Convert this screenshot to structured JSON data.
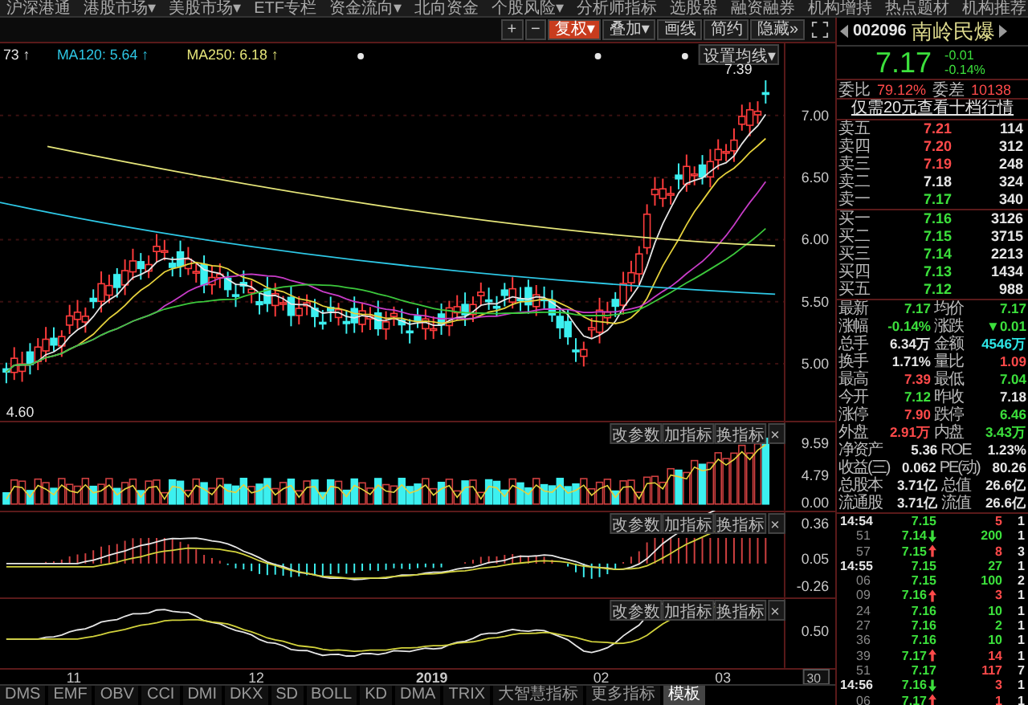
{
  "menu_bar": {
    "items": [
      "沪深港通",
      "港股市场▾",
      "美股市场▾",
      "ETF专栏",
      "资金流向▾",
      "北向资金",
      "个股风险▾",
      "分析师指标",
      "选股器",
      "融资融券",
      "机构增持",
      "热点题材",
      "机构推荐"
    ]
  },
  "toolbar": {
    "buttons": [
      {
        "label": "+",
        "selected": false
      },
      {
        "label": "−",
        "selected": false
      },
      {
        "label": "复权▾",
        "selected": true
      },
      {
        "label": "叠加▾",
        "selected": false
      },
      {
        "label": "画线",
        "selected": false
      },
      {
        "label": "简约",
        "selected": false
      },
      {
        "label": "隐藏»",
        "selected": false
      }
    ]
  },
  "main_chart": {
    "ma_legend": [
      {
        "text": "73 ↑",
        "color": "#e6e6e6"
      },
      {
        "text": "MA120: 5.64 ↑",
        "color": "#2ec8e6"
      },
      {
        "text": "MA250: 6.18 ↑",
        "color": "#e6e67a"
      }
    ],
    "ma_settings_button": "设置均线▾",
    "high_label": "7.39",
    "low_label": "4.60",
    "y_axis": [
      "7.00",
      "6.50",
      "6.00",
      "5.50",
      "5.00"
    ]
  },
  "volume_panel": {
    "y_axis": [
      "9.59",
      "4.79",
      "0.00"
    ],
    "buttons": [
      "改参数",
      "加指标",
      "换指标",
      "×"
    ]
  },
  "macd_panel": {
    "y_axis": [
      "0.36",
      "0.05",
      "-0.26"
    ],
    "buttons": [
      "改参数",
      "加指标",
      "换指标",
      "×"
    ]
  },
  "kdj_panel": {
    "y_axis": [
      "0.50"
    ],
    "buttons": [
      "改参数",
      "加指标",
      "换指标",
      "×"
    ]
  },
  "x_axis": {
    "labels": [
      "11",
      "12",
      "2019",
      "02",
      "03"
    ],
    "period_box": "30"
  },
  "indicator_tabs": [
    {
      "label": "DMS",
      "selected": false
    },
    {
      "label": "EMF",
      "selected": false
    },
    {
      "label": "OBV",
      "selected": false
    },
    {
      "label": "CCI",
      "selected": false
    },
    {
      "label": "DMI",
      "selected": false
    },
    {
      "label": "DKX",
      "selected": false
    },
    {
      "label": "SD",
      "selected": false
    },
    {
      "label": "BOLL",
      "selected": false
    },
    {
      "label": "KD",
      "selected": false
    },
    {
      "label": "DMA",
      "selected": false
    },
    {
      "label": "TRIX",
      "selected": false
    },
    {
      "label": "大智慧指标",
      "selected": false
    },
    {
      "label": "更多指标",
      "selected": false
    },
    {
      "label": "模板",
      "selected": true
    }
  ],
  "quote": {
    "code": "002096",
    "name": "南岭民爆",
    "price": "7.17",
    "change": "-0.01",
    "change_pct": "-0.14%",
    "order_ratio": [
      {
        "label": "委比",
        "value": "79.12%"
      },
      {
        "label": "委差",
        "value": "10138"
      }
    ],
    "promo_link": "仅需20元查看十档行情",
    "asks": [
      {
        "label": "卖五",
        "price": "7.21",
        "volume": "114",
        "color": "#ff4a4a"
      },
      {
        "label": "卖四",
        "price": "7.20",
        "volume": "312",
        "color": "#ff4a4a"
      },
      {
        "label": "卖三",
        "price": "7.19",
        "volume": "248",
        "color": "#ff4a4a"
      },
      {
        "label": "卖二",
        "price": "7.18",
        "volume": "324",
        "color": "#e6e6e6"
      },
      {
        "label": "卖一",
        "price": "7.17",
        "volume": "340",
        "color": "#3ce03c"
      }
    ],
    "bids": [
      {
        "label": "买一",
        "price": "7.16",
        "volume": "3126",
        "color": "#3ce03c"
      },
      {
        "label": "买二",
        "price": "7.15",
        "volume": "3715",
        "color": "#3ce03c"
      },
      {
        "label": "买三",
        "price": "7.14",
        "volume": "2213",
        "color": "#3ce03c"
      },
      {
        "label": "买四",
        "price": "7.13",
        "volume": "1434",
        "color": "#3ce03c"
      },
      {
        "label": "买五",
        "price": "7.12",
        "volume": "988",
        "color": "#3ce03c"
      }
    ],
    "stats": [
      {
        "left": {
          "label": "最新",
          "value": "7.17",
          "color": "#3ce03c"
        },
        "right": {
          "label": "均价",
          "value": "7.17",
          "color": "#3ce03c"
        }
      },
      {
        "left": {
          "label": "涨幅",
          "value": "-0.14%",
          "color": "#3ce03c"
        },
        "right": {
          "label": "涨跌",
          "value": "▼0.01",
          "color": "#3ce03c"
        }
      },
      {
        "left": {
          "label": "总手",
          "value": "6.34万",
          "color": "#e6e6e6"
        },
        "right": {
          "label": "金额",
          "value": "4546万",
          "color": "#2ee6e6"
        }
      },
      {
        "left": {
          "label": "换手",
          "value": "1.71%",
          "color": "#e6e6e6"
        },
        "right": {
          "label": "量比",
          "value": "1.09",
          "color": "#ff4a4a"
        }
      },
      {
        "left": {
          "label": "最高",
          "value": "7.39",
          "color": "#ff4a4a"
        },
        "right": {
          "label": "最低",
          "value": "7.04",
          "color": "#3ce03c"
        }
      },
      {
        "left": {
          "label": "今开",
          "value": "7.12",
          "color": "#3ce03c"
        },
        "right": {
          "label": "昨收",
          "value": "7.18",
          "color": "#e6e6e6"
        }
      },
      {
        "left": {
          "label": "涨停",
          "value": "7.90",
          "color": "#ff4a4a"
        },
        "right": {
          "label": "跌停",
          "value": "6.46",
          "color": "#3ce03c"
        }
      },
      {
        "left": {
          "label": "外盘",
          "value": "2.91万",
          "color": "#ff4a4a"
        },
        "right": {
          "label": "内盘",
          "value": "3.43万",
          "color": "#3ce03c"
        }
      },
      {
        "left": {
          "label": "净资产",
          "value": "5.36",
          "color": "#e6e6e6"
        },
        "right": {
          "label": "ROE",
          "value": "1.23%",
          "color": "#e6e6e6"
        }
      },
      {
        "left": {
          "label": "收益(三)",
          "value": "0.062",
          "color": "#e6e6e6"
        },
        "right": {
          "label": "PE(动)",
          "value": "80.26",
          "color": "#e6e6e6"
        }
      },
      {
        "left": {
          "label": "总股本",
          "value": "3.71亿",
          "color": "#e6e6e6"
        },
        "right": {
          "label": "总值",
          "value": "26.6亿",
          "color": "#e6e6e6"
        }
      },
      {
        "left": {
          "label": "流通股",
          "value": "3.71亿",
          "color": "#e6e6e6"
        },
        "right": {
          "label": "流值",
          "value": "26.6亿",
          "color": "#e6e6e6"
        }
      }
    ],
    "ticks": [
      {
        "time": "14:54",
        "kind": "minute",
        "price": "7.15",
        "volume": "5",
        "color": "#ff4a4a",
        "count": "1"
      },
      {
        "time": "51",
        "kind": "second",
        "price": "7.14",
        "rising": false,
        "volume": "200",
        "color": "#3ce03c",
        "count": "1"
      },
      {
        "time": "57",
        "kind": "second",
        "price": "7.15",
        "rising": true,
        "volume": "8",
        "color": "#ff4a4a",
        "count": "3"
      },
      {
        "time": "14:55",
        "kind": "minute",
        "price": "7.15",
        "volume": "27",
        "color": "#3ce03c",
        "count": "1"
      },
      {
        "time": "06",
        "kind": "second",
        "price": "7.15",
        "volume": "100",
        "color": "#3ce03c",
        "count": "2"
      },
      {
        "time": "09",
        "kind": "second",
        "price": "7.16",
        "rising": true,
        "volume": "3",
        "color": "#ff4a4a",
        "count": "1"
      },
      {
        "time": "24",
        "kind": "second",
        "price": "7.16",
        "volume": "10",
        "color": "#3ce03c",
        "count": "1"
      },
      {
        "time": "27",
        "kind": "second",
        "price": "7.16",
        "volume": "2",
        "color": "#3ce03c",
        "count": "1"
      },
      {
        "time": "36",
        "kind": "second",
        "price": "7.16",
        "volume": "10",
        "color": "#3ce03c",
        "count": "1"
      },
      {
        "time": "39",
        "kind": "second",
        "price": "7.17",
        "rising": true,
        "volume": "14",
        "color": "#ff4a4a",
        "count": "1"
      },
      {
        "time": "51",
        "kind": "second",
        "price": "7.17",
        "volume": "117",
        "color": "#ff4a4a",
        "count": "7"
      },
      {
        "time": "14:56",
        "kind": "minute",
        "price": "7.16",
        "rising": false,
        "volume": "3",
        "color": "#ff4a4a",
        "count": "1"
      },
      {
        "time": "06",
        "kind": "second",
        "price": "7.17",
        "rising": true,
        "volume": "1",
        "color": "#ff4a4a",
        "count": "1"
      }
    ]
  }
}
